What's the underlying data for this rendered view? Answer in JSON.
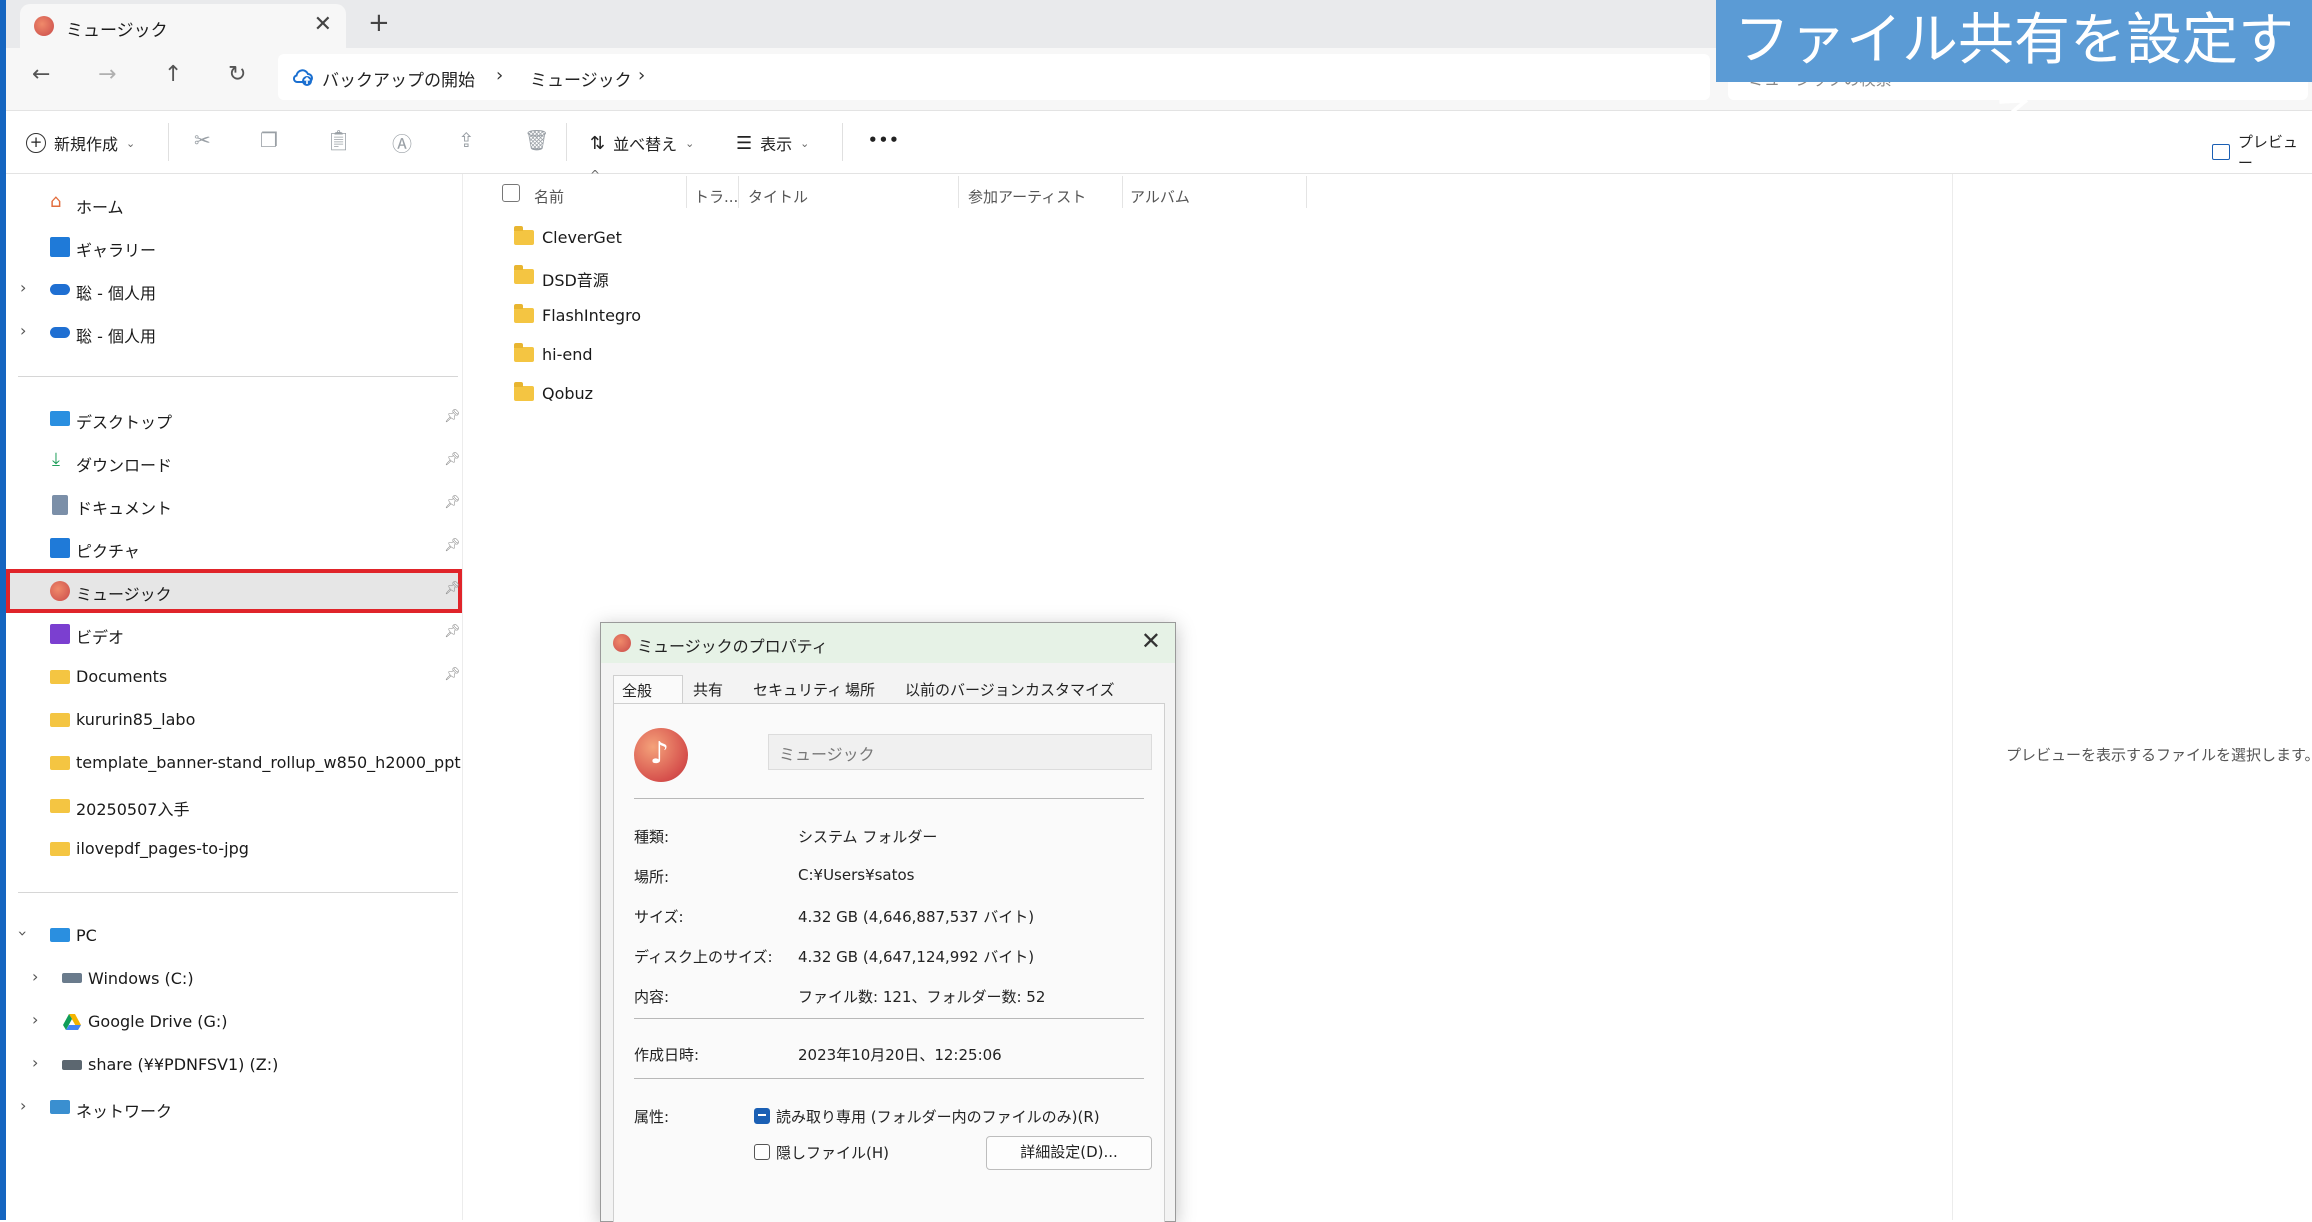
{
  "window": {
    "tab_title": "ミュージック",
    "tab_close": "✕",
    "new_tab": "+"
  },
  "nav": {
    "back": "←",
    "forward": "→",
    "up": "↑",
    "refresh": "↻",
    "breadcrumb": [
      "バックアップの開始",
      "ミュージック"
    ],
    "search_placeholder": "ミュージックの検索"
  },
  "toolbar": {
    "new_label": "新規作成",
    "sort_label": "並べ替え",
    "view_label": "表示",
    "more": "•••",
    "preview_label": "プレビュー"
  },
  "sidebar": {
    "top": [
      {
        "label": "ホーム",
        "icon": "home-icon"
      },
      {
        "label": "ギャラリー",
        "icon": "gallery-icon"
      },
      {
        "label": "聡 - 個人用",
        "icon": "onedrive-icon"
      },
      {
        "label": "聡 - 個人用",
        "icon": "onedrive-icon"
      }
    ],
    "quick": [
      {
        "label": "デスクトップ",
        "icon": "desktop-icon"
      },
      {
        "label": "ダウンロード",
        "icon": "download-icon"
      },
      {
        "label": "ドキュメント",
        "icon": "document-icon"
      },
      {
        "label": "ピクチャ",
        "icon": "pictures-icon"
      },
      {
        "label": "ミュージック",
        "icon": "music-icon"
      },
      {
        "label": "ビデオ",
        "icon": "video-icon"
      },
      {
        "label": "Documents",
        "icon": "folder-icon"
      },
      {
        "label": "kururin85_labo",
        "icon": "folder-icon"
      },
      {
        "label": "template_banner-stand_rollup_w850_h2000_ppt",
        "icon": "folder-icon"
      },
      {
        "label": "20250507入手",
        "icon": "folder-icon"
      },
      {
        "label": "ilovepdf_pages-to-jpg",
        "icon": "folder-icon"
      }
    ],
    "pc": [
      {
        "label": "PC",
        "icon": "pc-icon"
      },
      {
        "label": "Windows (C:)",
        "icon": "drive-icon"
      },
      {
        "label": "Google Drive (G:)",
        "icon": "google-drive-icon"
      },
      {
        "label": "share (¥¥PDNFSV1) (Z:)",
        "icon": "network-drive-icon"
      },
      {
        "label": "ネットワーク",
        "icon": "network-icon"
      }
    ]
  },
  "columns": [
    "名前",
    "トラ...",
    "タイトル",
    "参加アーティスト",
    "アルバム"
  ],
  "files": [
    "CleverGet",
    "DSD音源",
    "FlashIntegro",
    "hi-end",
    "Qobuz"
  ],
  "preview_message": "プレビューを表示するファイルを選択します。",
  "banner": "ファイル共有を設定する",
  "dialog": {
    "title": "ミュージックのプロパティ",
    "tabs": [
      "全般",
      "共有",
      "セキュリティ",
      "場所",
      "以前のバージョン",
      "カスタマイズ"
    ],
    "name": "ミュージック",
    "props": [
      {
        "label": "種類:",
        "value": "システム フォルダー"
      },
      {
        "label": "場所:",
        "value": "C:¥Users¥satos"
      },
      {
        "label": "サイズ:",
        "value": "4.32 GB (4,646,887,537 バイト)"
      },
      {
        "label": "ディスク上のサイズ:",
        "value": "4.32 GB (4,647,124,992 バイト)"
      },
      {
        "label": "内容:",
        "value": "ファイル数: 121、フォルダー数: 52"
      }
    ],
    "created_label": "作成日時:",
    "created_value": "2023年10月20日、12:25:06",
    "attr_label": "属性:",
    "readonly_label": "読み取り専用 (フォルダー内のファイルのみ)(R)",
    "hidden_label": "隠しファイル(H)",
    "advanced_button": "詳細設定(D)..."
  }
}
